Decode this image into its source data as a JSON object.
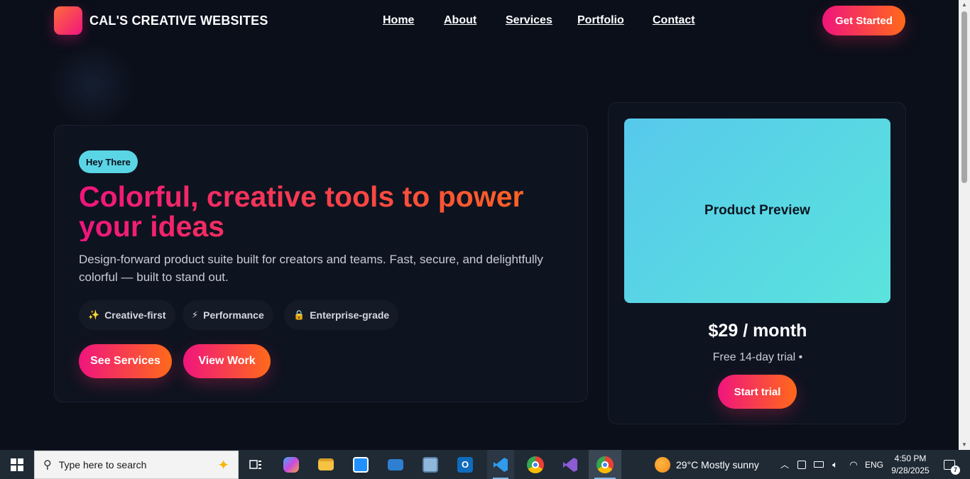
{
  "header": {
    "brand": "CAL'S CREATIVE WEBSITES",
    "nav": [
      "Home",
      "About",
      "Services",
      "Portfolio",
      "Contact"
    ],
    "cta": "Get Started"
  },
  "hero": {
    "badge": "Hey There",
    "headline": "Colorful, creative tools to power your ideas",
    "subtext": "Design-forward product suite built for creators and teams. Fast, secure, and delightfully colorful — built to stand out.",
    "features": [
      {
        "icon": "✨",
        "label": "Creative-first"
      },
      {
        "icon": "⚡",
        "label": "Performance"
      },
      {
        "icon": "🔒",
        "label": "Enterprise-grade"
      }
    ],
    "buttons": {
      "services": "See Services",
      "work": "View Work"
    }
  },
  "product": {
    "preview": "Product Preview",
    "price": "$29 / month",
    "trial": "Free 14-day trial •",
    "cta": "Start trial"
  },
  "colors": {
    "accent_start": "#f0157d",
    "accent_end": "#ff6a1a",
    "preview": "#5ad5e6"
  },
  "taskbar": {
    "search_placeholder": "Type here to search",
    "weather": "29°C  Mostly sunny",
    "language": "ENG",
    "time": "4:50 PM",
    "date": "9/28/2025",
    "notifications": "7"
  }
}
